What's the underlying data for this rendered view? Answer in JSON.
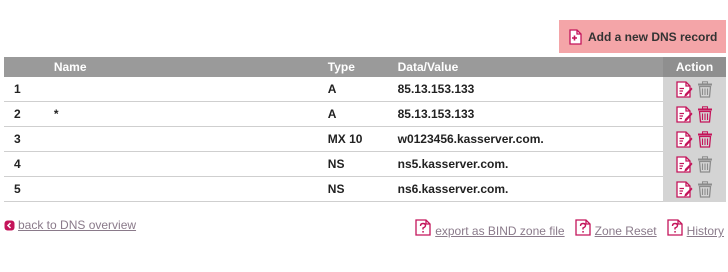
{
  "toolbar": {
    "add_record_label": "Add a new DNS record"
  },
  "table": {
    "headers": {
      "name": "Name",
      "type": "Type",
      "value": "Data/Value",
      "action": "Action"
    },
    "rows": [
      {
        "num": "1",
        "name": "",
        "type": "A",
        "value": "85.13.153.133",
        "delete_active": false
      },
      {
        "num": "2",
        "name": "*",
        "type": "A",
        "value": "85.13.153.133",
        "delete_active": true
      },
      {
        "num": "3",
        "name": "",
        "type": "MX 10",
        "value": "w0123456.kasserver.com.",
        "delete_active": true
      },
      {
        "num": "4",
        "name": "",
        "type": "NS",
        "value": "ns5.kasserver.com.",
        "delete_active": false
      },
      {
        "num": "5",
        "name": "",
        "type": "NS",
        "value": "ns6.kasserver.com.",
        "delete_active": false
      }
    ]
  },
  "footer": {
    "back_label": "back to DNS overview",
    "export_label": "export as BIND zone file",
    "reset_label": "Zone Reset",
    "history_label": "History"
  },
  "colors": {
    "accent": "#c4145a",
    "add_button_bg": "#f4a5a8",
    "header_bg": "#9a9a9a",
    "action_bg": "#d4d4d4",
    "link": "#8a7a8a",
    "trash_inactive": "#8c8c8c"
  },
  "icons": {
    "add": "add-document-icon",
    "edit": "edit-document-icon",
    "delete": "trash-icon",
    "back": "back-arrow-icon",
    "export": "help-document-icon",
    "reset": "help-document-icon",
    "history": "help-document-icon"
  }
}
